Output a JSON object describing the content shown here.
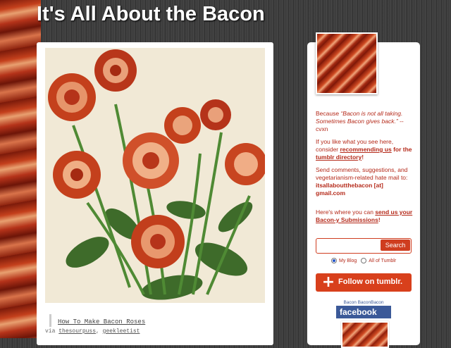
{
  "header": {
    "title": "It's All About the Bacon"
  },
  "post": {
    "link_text": "How To Make Bacon Roses",
    "via_label": "via",
    "via_sources": [
      "thesourpuss",
      "geekleetist"
    ],
    "via_separator": ","
  },
  "sidebar": {
    "quote_intro": "Because ",
    "quote": "“Bacon is not all taking. Sometimes Bacon gives back.”",
    "quote_attribution": " -- cvxn",
    "recommend_pre": "If you like what you see here, consider ",
    "recommend_link": "recommending us",
    "recommend_mid": " for the ",
    "directory_link": "tumblr directory",
    "recommend_end": "!",
    "contact_text": "Send comments, suggestions, and vegetarianism-related hate mail to:",
    "contact_email": "itsallaboutthebacon [at] gmail.com",
    "submit_pre": "Here's where you can ",
    "submit_link": "send us your Bacon-y Submissions",
    "submit_end": "!",
    "search": {
      "placeholder": "",
      "button_label": "Search",
      "options": [
        "My Blog",
        "All of Tumblr"
      ],
      "selected": "My Blog"
    },
    "follow_label": "Follow on tumblr.",
    "facebook": {
      "caption": "Bacon BaconBacon",
      "badge": "facebook"
    }
  },
  "colors": {
    "accent": "#cf3d1f",
    "sidebar_text": "#b52a1a",
    "facebook_blue": "#3b5998",
    "background": "#3a3a3a"
  }
}
